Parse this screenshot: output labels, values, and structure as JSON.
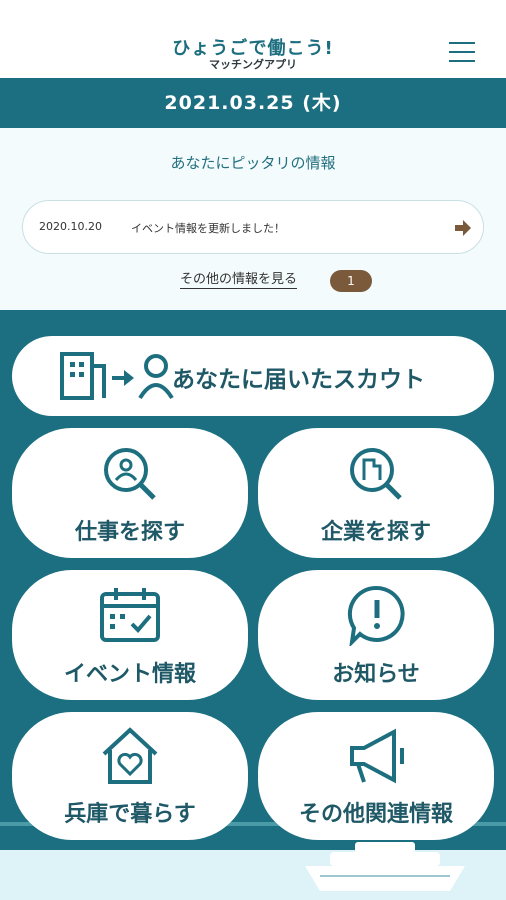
{
  "header": {
    "logo_main": "ひょうごで働こう!",
    "logo_sub": "マッチングアプリ",
    "menu_icon": "hamburger-icon"
  },
  "date": "2021.03.25 (木)",
  "info": {
    "title": "あなたにピッタリの情報",
    "news_date": "2020.10.20",
    "news_text": "イベント情報を更新しました！",
    "more_label": "その他の情報を見る",
    "more_count": "1"
  },
  "menu": {
    "scout": "あなたに届いたスカウト",
    "jobs": "仕事を探す",
    "companies": "企業を探す",
    "events": "イベント情報",
    "notices": "お知らせ",
    "living": "兵庫で暮らす",
    "other": "その他関連情報"
  },
  "colors": {
    "teal": "#1c6f80",
    "brown": "#7a5a3a",
    "card": "#ffffff"
  }
}
